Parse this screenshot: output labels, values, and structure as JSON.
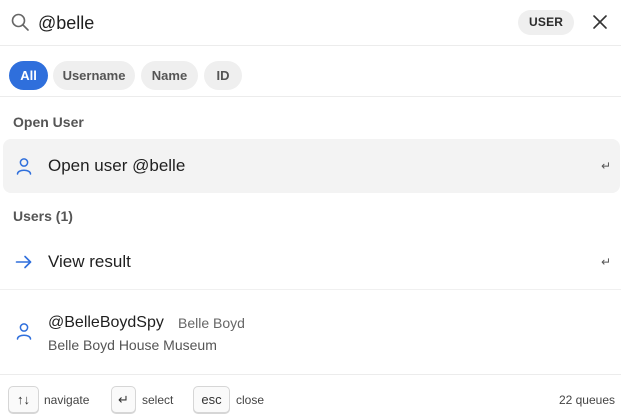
{
  "search": {
    "query": "@belle",
    "scope": "USER"
  },
  "filters": [
    {
      "label": "All",
      "active": true
    },
    {
      "label": "Username",
      "active": false
    },
    {
      "label": "Name",
      "active": false
    },
    {
      "label": "ID",
      "active": false
    }
  ],
  "sections": {
    "open_user": {
      "label": "Open User",
      "item": {
        "label": "Open user @belle",
        "icon": "user-icon",
        "enter": "↵"
      }
    },
    "users": {
      "label": "Users (1)",
      "view_result": {
        "label": "View result",
        "icon": "arrow-right-icon",
        "enter": "↵"
      },
      "results": [
        {
          "handle": "@BelleBoydSpy",
          "name": "Belle Boyd",
          "org": "Belle Boyd House Museum",
          "icon": "user-icon"
        }
      ]
    }
  },
  "footer": {
    "navigate_key": "↑↓",
    "navigate_label": "navigate",
    "select_key": "↵",
    "select_label": "select",
    "close_key": "esc",
    "close_label": "close",
    "queues": "22 queues"
  },
  "colors": {
    "accent": "#2f6fdc",
    "chip_bg": "#efefef",
    "highlight_bg": "#f3f3f3"
  }
}
